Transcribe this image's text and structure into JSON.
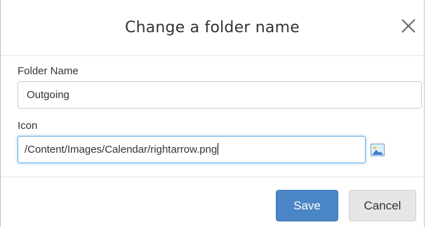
{
  "dialog": {
    "title": "Change a folder name",
    "close_icon": "close-icon"
  },
  "form": {
    "folder_name": {
      "label": "Folder Name",
      "value": "Outgoing"
    },
    "icon": {
      "label": "Icon",
      "value": "/Content/Images/Calendar/rightarrow.png",
      "picker_icon": "image-icon"
    }
  },
  "footer": {
    "save_label": "Save",
    "cancel_label": "Cancel"
  },
  "colors": {
    "primary": "#4a86c5",
    "focus_border": "#66afe9",
    "secondary_button": "#e6e6e6"
  }
}
